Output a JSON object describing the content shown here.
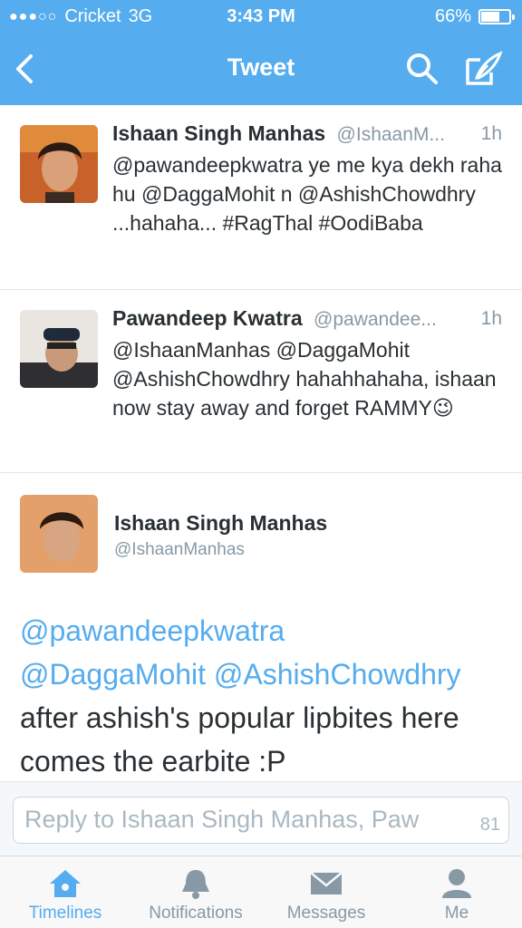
{
  "status_bar": {
    "carrier": "Cricket",
    "network": "3G",
    "time": "3:43 PM",
    "battery_text": "66%",
    "battery_level": 0.66
  },
  "nav": {
    "title": "Tweet",
    "back_icon": "chevron-left-icon",
    "search_icon": "search-icon",
    "compose_icon": "compose-icon"
  },
  "tweets": [
    {
      "name": "Ishaan Singh Manhas",
      "handle": "@IshaanM...",
      "time": "1h",
      "text": "@pawandeepkwatra ye me kya dekh raha hu @DaggaMohit n @AshishChowdhry ...hahaha... #RagThal #OodiBaba"
    },
    {
      "name": "Pawandeep Kwatra",
      "handle": "@pawandee...",
      "time": "1h",
      "text": "@IshaanManhas @DaggaMohit @AshishChowdhry hahahhahaha, ishaan now stay away and forget RAMMY😉"
    }
  ],
  "focus_tweet": {
    "name": "Ishaan Singh Manhas",
    "handle": "@IshaanManhas",
    "mention1": "@pawandeepkwatra",
    "mention2": "@DaggaMohit",
    "mention3": "@AshishChowdhry",
    "body": "after ashish's popular lipbites here comes the earbite :P"
  },
  "reply": {
    "placeholder": "Reply to Ishaan Singh Manhas, Paw",
    "char_count": "81"
  },
  "tabs": [
    {
      "label": "Timelines",
      "icon": "home-icon",
      "active": true
    },
    {
      "label": "Notifications",
      "icon": "bell-icon",
      "active": false
    },
    {
      "label": "Messages",
      "icon": "envelope-icon",
      "active": false
    },
    {
      "label": "Me",
      "icon": "person-icon",
      "active": false
    }
  ],
  "colors": {
    "brand": "#55acee",
    "text": "#292f33",
    "muted": "#8899a6"
  }
}
